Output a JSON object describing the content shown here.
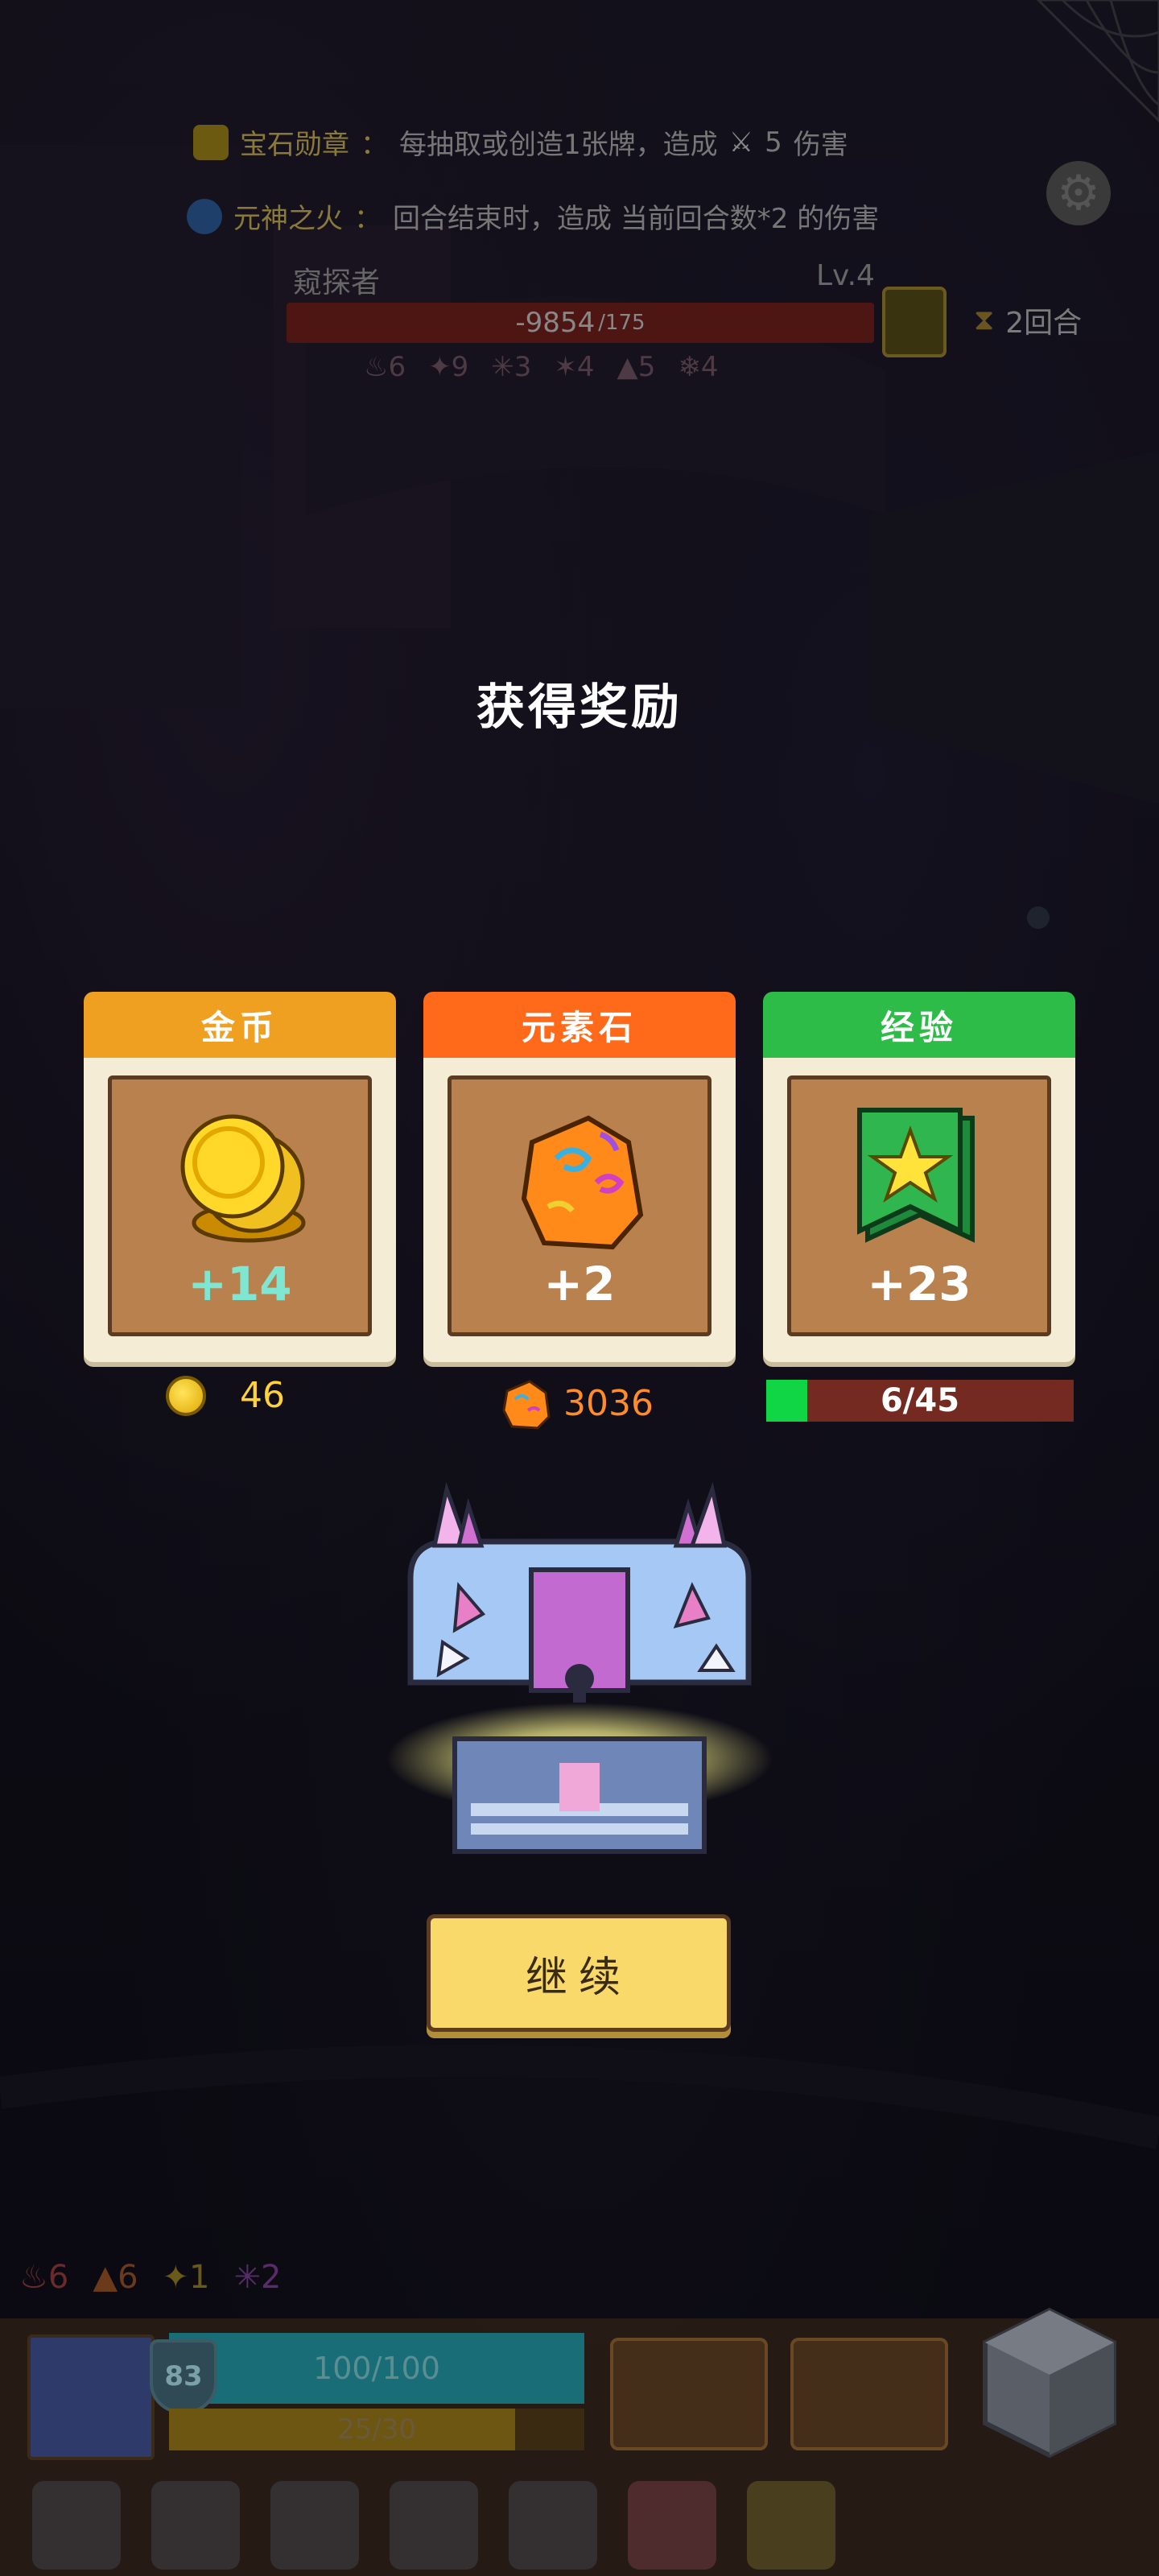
{
  "buffs": [
    {
      "name": "宝石勋章",
      "sep": "：",
      "desc": "每抽取或创造1张牌，造成",
      "value": "5",
      "suffix": "伤害"
    },
    {
      "name": "元神之火",
      "sep": "：",
      "desc": "回合结束时，造成 当前回合数*2 的伤害"
    }
  ],
  "enemy": {
    "name": "窥探者",
    "level": "Lv.4",
    "hp": "-9854",
    "hp_max": "/175"
  },
  "enemy_stats": [
    "6",
    "9",
    "3",
    "4",
    "5",
    "4"
  ],
  "turn": {
    "label": "2回合"
  },
  "rewards": {
    "title": "获得奖励",
    "cards": [
      {
        "header": "金币",
        "amount": "+14",
        "color": "#f0a020",
        "icon": "gold-coins"
      },
      {
        "header": "元素石",
        "amount": "+2",
        "color": "#ff6a1a",
        "icon": "element-stone"
      },
      {
        "header": "经验",
        "amount": "+23",
        "color": "#2ebc48",
        "icon": "star-banner"
      }
    ],
    "gold_total": "46",
    "stone_total": "3036",
    "exp": {
      "text": "6/45",
      "progress": 0.133
    }
  },
  "continue_label": "继续",
  "player": {
    "elements": [
      "6",
      "6",
      "1",
      "2"
    ],
    "shield": "83",
    "hp": "100/100",
    "mp": "25/30",
    "mp_progress": 0.833
  }
}
